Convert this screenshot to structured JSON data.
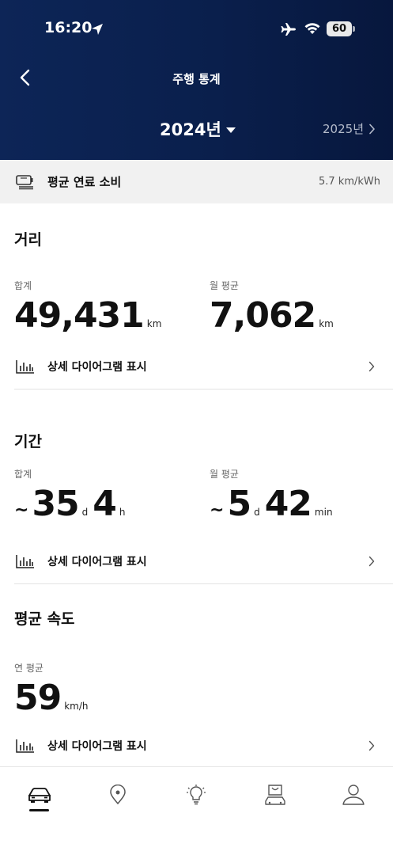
{
  "status": {
    "time": "16:20",
    "battery": "60"
  },
  "nav": {
    "title": "주행 통계",
    "year": "2024년",
    "next_year": "2025년"
  },
  "fuel": {
    "label": "평균 연료 소비",
    "value": "5.7 km/kWh"
  },
  "distance": {
    "title": "거리",
    "total_label": "합계",
    "total_value": "49,431",
    "total_unit": "km",
    "monthly_label": "월 평균",
    "monthly_value": "7,062",
    "monthly_unit": "km",
    "diagram_label": "상세 다이어그램 표시"
  },
  "duration": {
    "title": "기간",
    "total_label": "합계",
    "total_tilde": "~",
    "total_days": "35",
    "total_days_unit": "d",
    "total_hours": "4",
    "total_hours_unit": "h",
    "monthly_label": "월 평균",
    "monthly_tilde": "~",
    "monthly_days": "5",
    "monthly_days_unit": "d",
    "monthly_minutes": "42",
    "monthly_minutes_unit": "min",
    "diagram_label": "상세 다이어그램 표시"
  },
  "speed": {
    "title": "평균 속도",
    "yearly_label": "연 평균",
    "yearly_value": "59",
    "yearly_unit": "km/h",
    "diagram_label": "상세 다이어그램 표시"
  },
  "tabbar": {
    "items": [
      "car-icon",
      "location-pin-icon",
      "lightbulb-icon",
      "shop-icon",
      "profile-icon"
    ],
    "active": 0
  }
}
